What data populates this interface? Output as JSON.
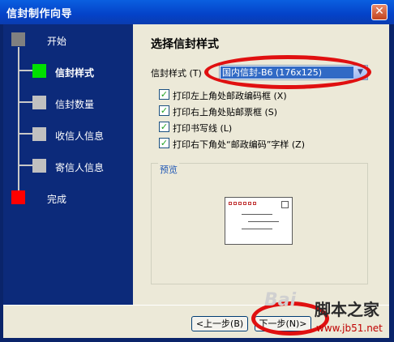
{
  "window": {
    "title": "信封制作向导",
    "close_glyph": "✕"
  },
  "steps": [
    {
      "label": "开始",
      "status": "done",
      "color": "#808080"
    },
    {
      "label": "信封样式",
      "status": "current",
      "color": "#00e000"
    },
    {
      "label": "信封数量",
      "status": "pending",
      "color": "#c0c0c0"
    },
    {
      "label": "收信人信息",
      "status": "pending",
      "color": "#c0c0c0"
    },
    {
      "label": "寄信人信息",
      "status": "pending",
      "color": "#c0c0c0"
    },
    {
      "label": "完成",
      "status": "end",
      "color": "#ff0000"
    }
  ],
  "main": {
    "heading": "选择信封样式",
    "style_label": "信封样式 (T)",
    "style_value": "国内信封-B6 (176x125)",
    "checkboxes": [
      {
        "label": "打印左上角处邮政编码框 (X)",
        "checked": true
      },
      {
        "label": "打印右上角处贴邮票框 (S)",
        "checked": true
      },
      {
        "label": "打印书写线 (L)",
        "checked": true
      },
      {
        "label": "打印右下角处“邮政编码”字样 (Z)",
        "checked": true
      }
    ],
    "preview_label": "预览"
  },
  "buttons": {
    "prev": "<上一步(B)",
    "next": "下一步(N)>"
  },
  "watermark": {
    "logo": "Bai",
    "site_cn": "脚本之家",
    "site_url": "www.jb51.net"
  },
  "annotation_color": "#e01010"
}
